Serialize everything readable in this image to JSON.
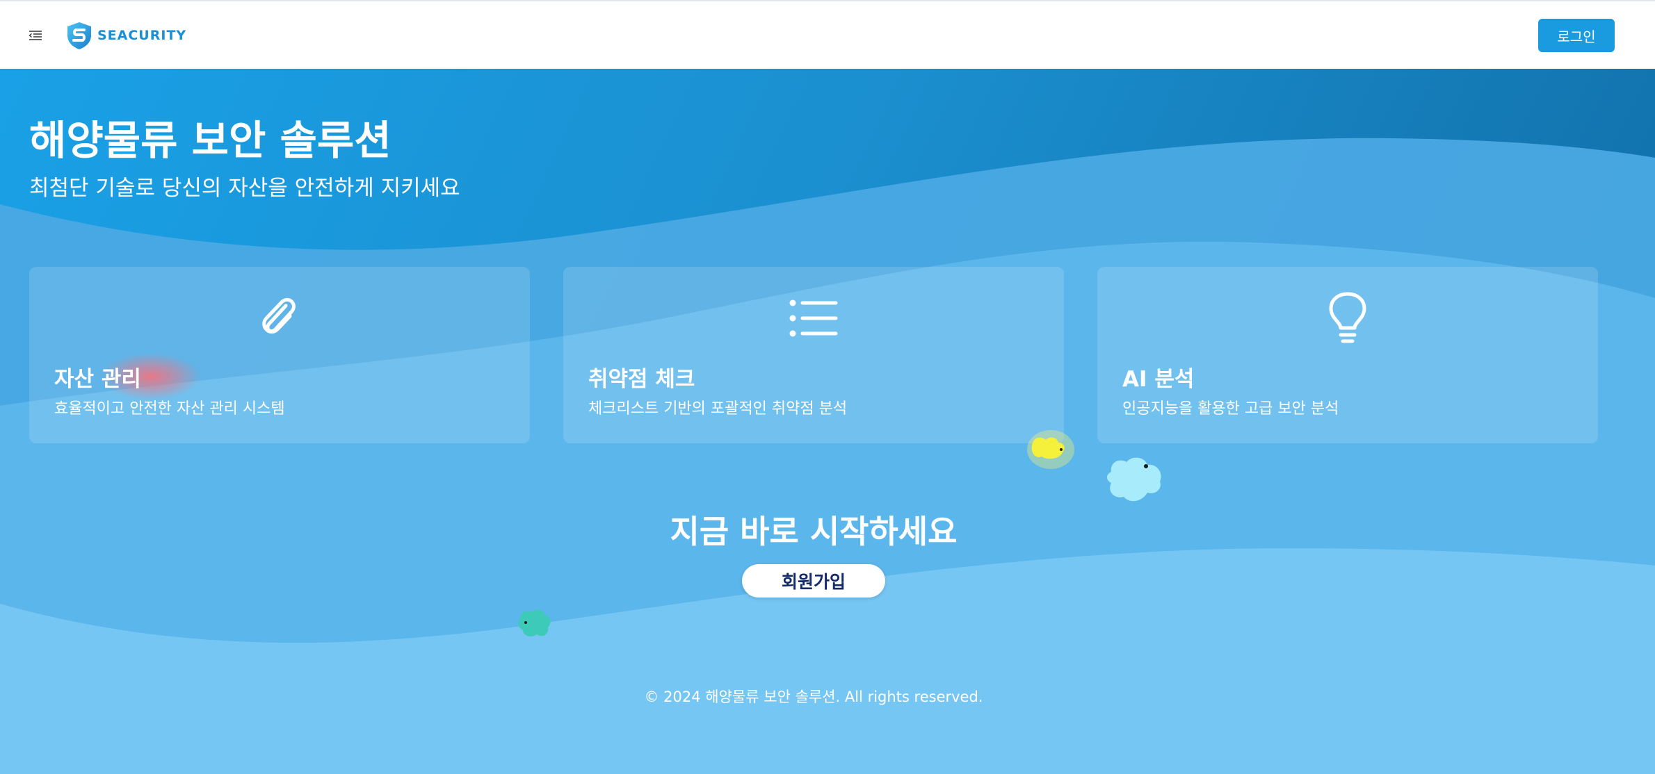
{
  "header": {
    "brand": "SEACURITY",
    "login_label": "로그인"
  },
  "hero": {
    "title": "해양물류 보안 솔루션",
    "subtitle": "최첨단 기술로 당신의 자산을 안전하게 지키세요"
  },
  "features": [
    {
      "icon": "paperclip-icon",
      "title": "자산 관리",
      "description": "효율적이고 안전한 자산 관리 시스템"
    },
    {
      "icon": "list-icon",
      "title": "취약점 체크",
      "description": "체크리스트 기반의 포괄적인 취약점 분석"
    },
    {
      "icon": "lightbulb-icon",
      "title": "AI 분석",
      "description": "인공지능을 활용한 고급 보안 분석"
    }
  ],
  "cta": {
    "title": "지금 바로 시작하세요",
    "signup_label": "회원가입"
  },
  "footer": {
    "copyright": "© 2024 해양물류 보안 솔루션. All rights reserved."
  },
  "colors": {
    "primary": "#1a9be0",
    "brand": "#1a8fd6",
    "signup_text": "#132a6b"
  }
}
